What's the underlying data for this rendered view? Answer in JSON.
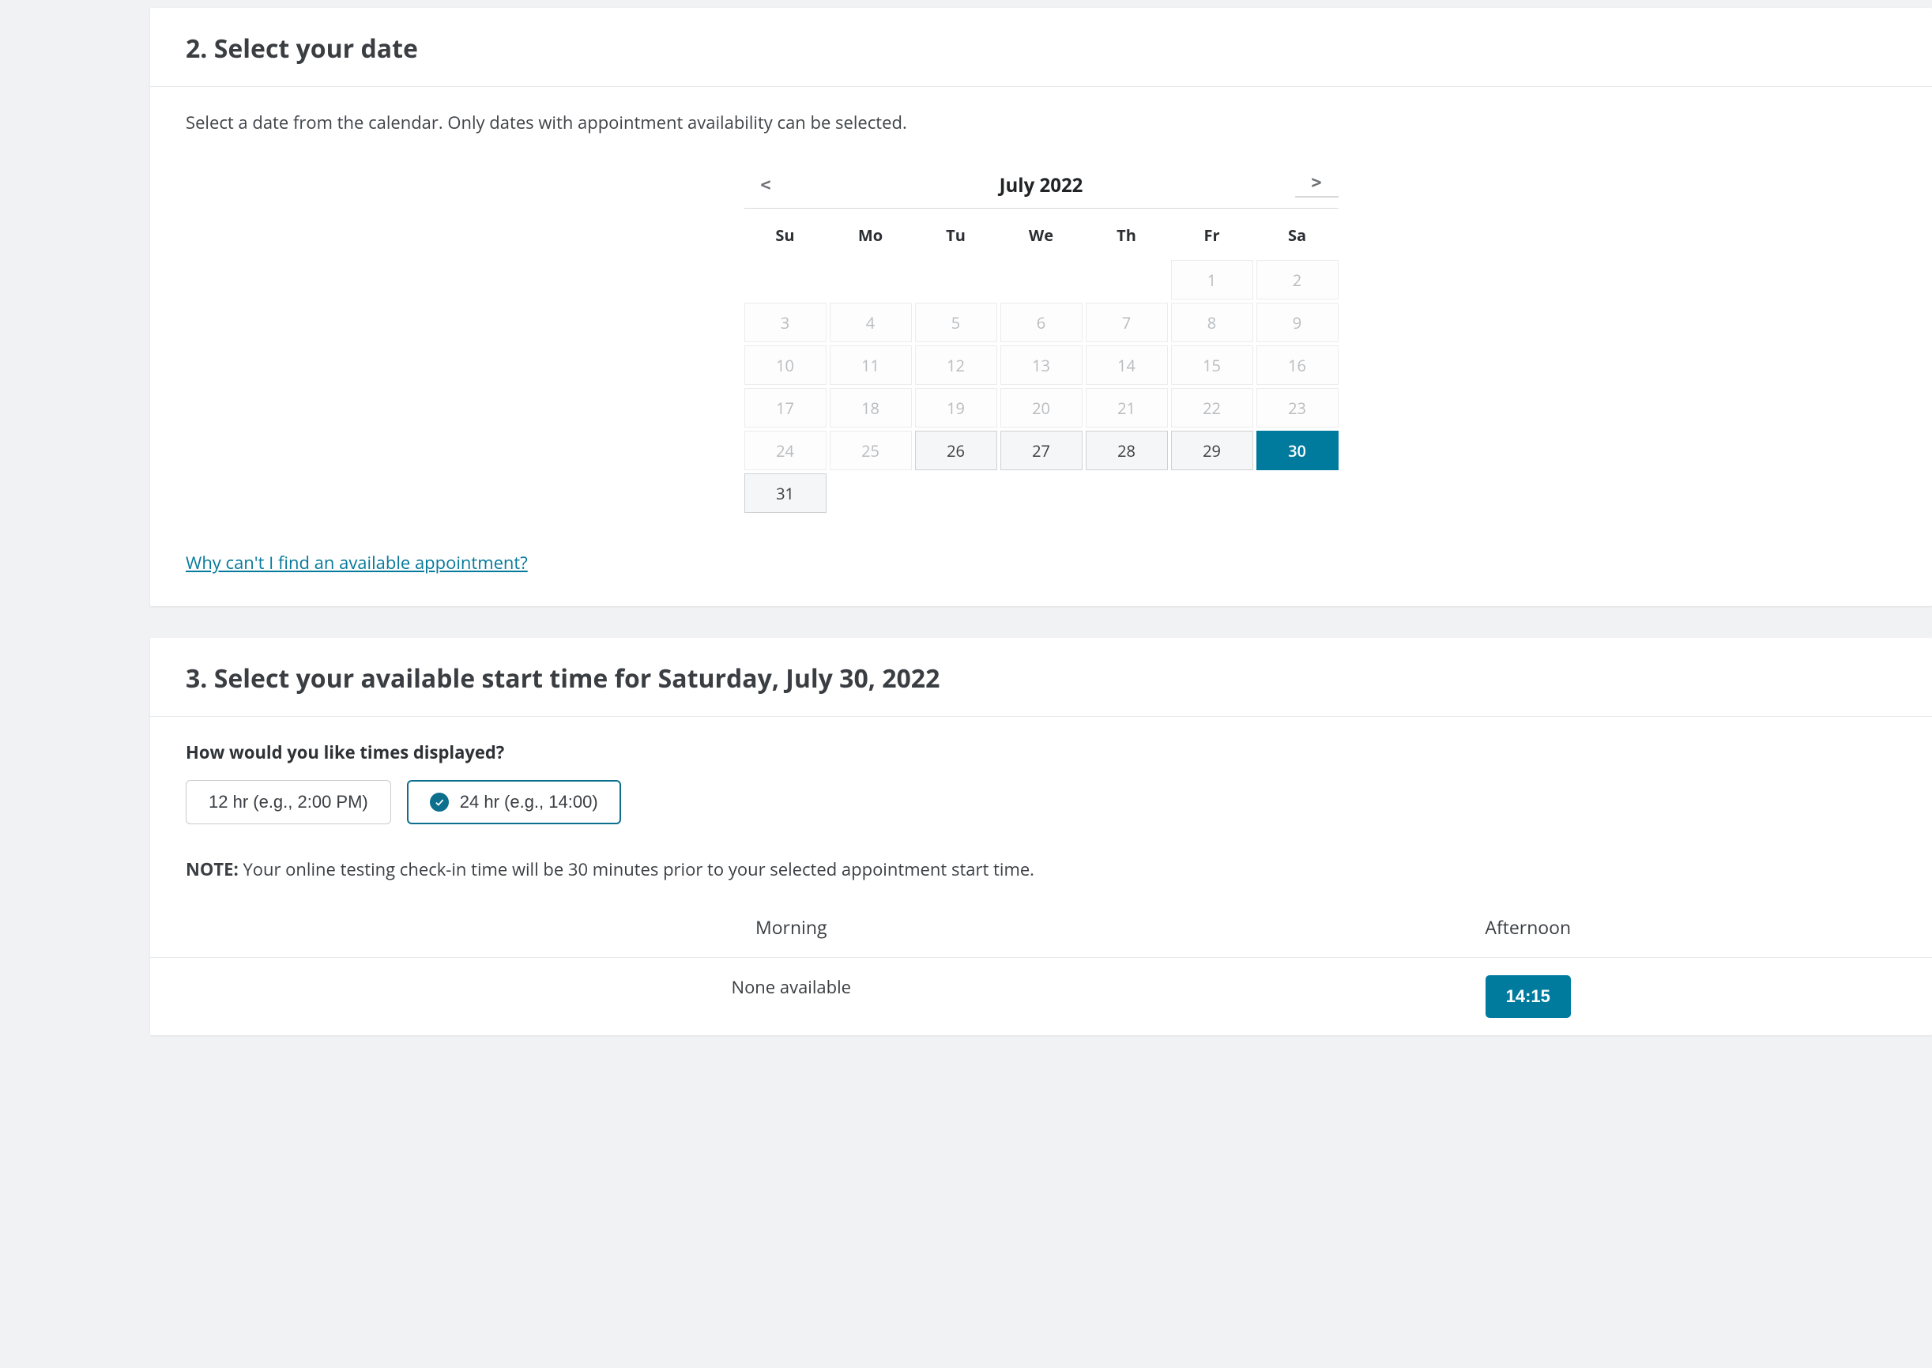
{
  "section2": {
    "heading": "2. Select your date",
    "instruction": "Select a date from the calendar. Only dates with appointment availability can be selected.",
    "calendar": {
      "prev_glyph": "<",
      "next_glyph": ">",
      "title": "July 2022",
      "dow": [
        "Su",
        "Mo",
        "Tu",
        "We",
        "Th",
        "Fr",
        "Sa"
      ],
      "leading_blanks": 5,
      "days": [
        {
          "n": "1",
          "state": "disabled"
        },
        {
          "n": "2",
          "state": "disabled"
        },
        {
          "n": "3",
          "state": "disabled"
        },
        {
          "n": "4",
          "state": "disabled"
        },
        {
          "n": "5",
          "state": "disabled"
        },
        {
          "n": "6",
          "state": "disabled"
        },
        {
          "n": "7",
          "state": "disabled"
        },
        {
          "n": "8",
          "state": "disabled"
        },
        {
          "n": "9",
          "state": "disabled"
        },
        {
          "n": "10",
          "state": "disabled"
        },
        {
          "n": "11",
          "state": "disabled"
        },
        {
          "n": "12",
          "state": "disabled"
        },
        {
          "n": "13",
          "state": "disabled"
        },
        {
          "n": "14",
          "state": "disabled"
        },
        {
          "n": "15",
          "state": "disabled"
        },
        {
          "n": "16",
          "state": "disabled"
        },
        {
          "n": "17",
          "state": "disabled"
        },
        {
          "n": "18",
          "state": "disabled"
        },
        {
          "n": "19",
          "state": "disabled"
        },
        {
          "n": "20",
          "state": "disabled"
        },
        {
          "n": "21",
          "state": "disabled"
        },
        {
          "n": "22",
          "state": "disabled"
        },
        {
          "n": "23",
          "state": "disabled"
        },
        {
          "n": "24",
          "state": "disabled"
        },
        {
          "n": "25",
          "state": "disabled"
        },
        {
          "n": "26",
          "state": "available"
        },
        {
          "n": "27",
          "state": "available"
        },
        {
          "n": "28",
          "state": "available"
        },
        {
          "n": "29",
          "state": "available"
        },
        {
          "n": "30",
          "state": "selected"
        },
        {
          "n": "31",
          "state": "available"
        }
      ]
    },
    "help_link": "Why can't I find an available appointment?"
  },
  "section3": {
    "heading": "3. Select your available start time for Saturday, July 30, 2022",
    "display_question": "How would you like times displayed?",
    "format_options": [
      {
        "label": "12 hr (e.g., 2:00 PM)",
        "selected": false
      },
      {
        "label": "24 hr (e.g., 14:00)",
        "selected": true
      }
    ],
    "note_prefix": "NOTE:",
    "note_text": " Your online testing check-in time will be 30 minutes prior to your selected appointment start time.",
    "columns": {
      "morning_header": "Morning",
      "afternoon_header": "Afternoon",
      "morning_none": "None available",
      "afternoon_slots": [
        "14:15"
      ]
    }
  }
}
